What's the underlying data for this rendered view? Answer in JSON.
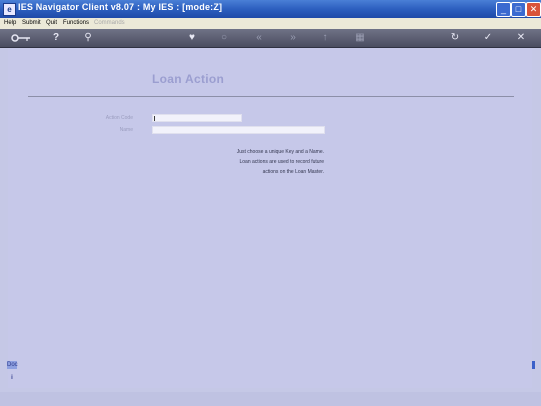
{
  "window": {
    "title": "IES Navigator Client v8.07 : My IES :       [mode:Z]"
  },
  "titlebar": {
    "minimize": "_",
    "maximize": "□",
    "close": "✕"
  },
  "menu": [
    {
      "label": "Help",
      "enabled": true
    },
    {
      "label": "Submit",
      "enabled": true
    },
    {
      "label": "Quit",
      "enabled": true
    },
    {
      "label": "Functions",
      "enabled": true
    },
    {
      "label": "Commands",
      "enabled": false
    }
  ],
  "toolbar": {
    "key_icon": "key-icon",
    "help_glyph": "?",
    "search_glyph": "⚲",
    "heart_glyph": "♥",
    "circle_glyph": "○",
    "back_glyph": "«",
    "forward_glyph": "»",
    "up_glyph": "↑",
    "list_glyph": "▦",
    "refresh_glyph": "↻",
    "check_glyph": "✓",
    "close_glyph": "✕"
  },
  "form": {
    "heading": "Loan Action",
    "action_code_label": "Action Code",
    "action_code_value": "",
    "name_label": "Name",
    "name_value": "",
    "hint_line1": "Just choose a unique Key and a Name.",
    "hint_line2": "Loan actions are used to record future",
    "hint_line3": "actions on the Loan Master."
  },
  "left_icons": {
    "top": "Doc",
    "bottom": "i"
  },
  "colors": {
    "titlebar": "#2d5fbf",
    "background": "#c6c8e9",
    "heading": "#9b9ed0"
  }
}
